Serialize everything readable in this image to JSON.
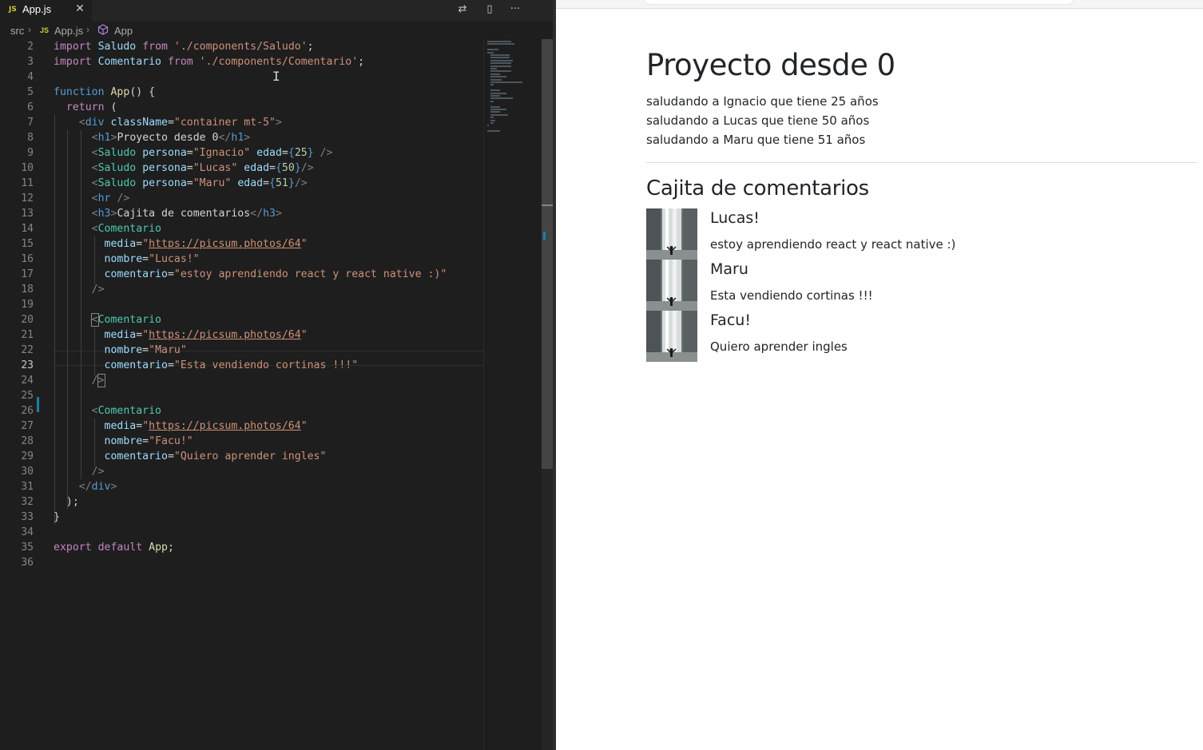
{
  "editor": {
    "tab": {
      "badge": "JS",
      "label": "App.js",
      "close": "✕"
    },
    "actions": {
      "compare": "⇄",
      "split": "▯",
      "more": "···"
    },
    "breadcrumbs": {
      "folder": "src",
      "file_badge": "JS",
      "file": "App.js",
      "symbol": "App",
      "sep": "›"
    },
    "lines": [
      {
        "n": "2"
      },
      {
        "n": "3"
      },
      {
        "n": "4"
      },
      {
        "n": "5"
      },
      {
        "n": "6"
      },
      {
        "n": "7"
      },
      {
        "n": "8"
      },
      {
        "n": "9"
      },
      {
        "n": "10"
      },
      {
        "n": "11"
      },
      {
        "n": "12"
      },
      {
        "n": "13"
      },
      {
        "n": "14"
      },
      {
        "n": "15"
      },
      {
        "n": "16"
      },
      {
        "n": "17"
      },
      {
        "n": "18"
      },
      {
        "n": "19"
      },
      {
        "n": "20"
      },
      {
        "n": "21"
      },
      {
        "n": "22"
      },
      {
        "n": "23"
      },
      {
        "n": "24"
      },
      {
        "n": "25"
      },
      {
        "n": "26"
      },
      {
        "n": "27"
      },
      {
        "n": "28"
      },
      {
        "n": "29"
      },
      {
        "n": "30"
      },
      {
        "n": "31"
      },
      {
        "n": "32"
      },
      {
        "n": "33"
      },
      {
        "n": "34"
      },
      {
        "n": "35"
      },
      {
        "n": "36"
      }
    ],
    "code": {
      "import": "import",
      "from": "from",
      "function": "function",
      "return": "return",
      "export": "export",
      "default": "default",
      "Saludo": "Saludo",
      "Comentario": "Comentario",
      "App": "App",
      "path_saludo": "'./components/Saludo'",
      "path_comentario": "'./components/Comentario'",
      "div": "div",
      "h1": "h1",
      "h3": "h3",
      "hr": "hr",
      "className": "className",
      "container": "\"container mt-5\"",
      "h1_text": "Proyecto desde 0",
      "h3_text": "Cajita de comentarios",
      "persona": "persona",
      "edad": "edad",
      "media": "media",
      "nombre": "nombre",
      "comentario": "comentario",
      "p1": "\"Ignacio\"",
      "e1": "25",
      "p2": "\"Lucas\"",
      "e2": "50",
      "p3": "\"Maru\"",
      "e3": "51",
      "url": "https://picsum.photos/64",
      "n1": "\"Lucas!\"",
      "c1": "\"estoy aprendiendo react y react native :)\"",
      "n2": "\"Maru\"",
      "c2": "\"Esta vendiendo cortinas !!!\"",
      "n3": "\"Facu!\"",
      "c3": "\"Quiero aprender ingles\""
    }
  },
  "page": {
    "title": "Proyecto desde 0",
    "saludos": [
      "saludando a Ignacio que tiene 25 años",
      "saludando a Lucas que tiene 50 años",
      "saludando a Maru que tiene 51 años"
    ],
    "comments_title": "Cajita de comentarios",
    "comments": [
      {
        "nombre": "Lucas!",
        "comentario": "estoy aprendiendo react y react native :)"
      },
      {
        "nombre": "Maru",
        "comentario": "Esta vendiendo cortinas !!!"
      },
      {
        "nombre": "Facu!",
        "comentario": "Quiero aprender ingles"
      }
    ]
  },
  "colors": {
    "editor_bg": "#1e1e1e",
    "keyword": "#c586c0",
    "string": "#ce9178",
    "component": "#4ec9b0",
    "page_text": "#212529"
  }
}
